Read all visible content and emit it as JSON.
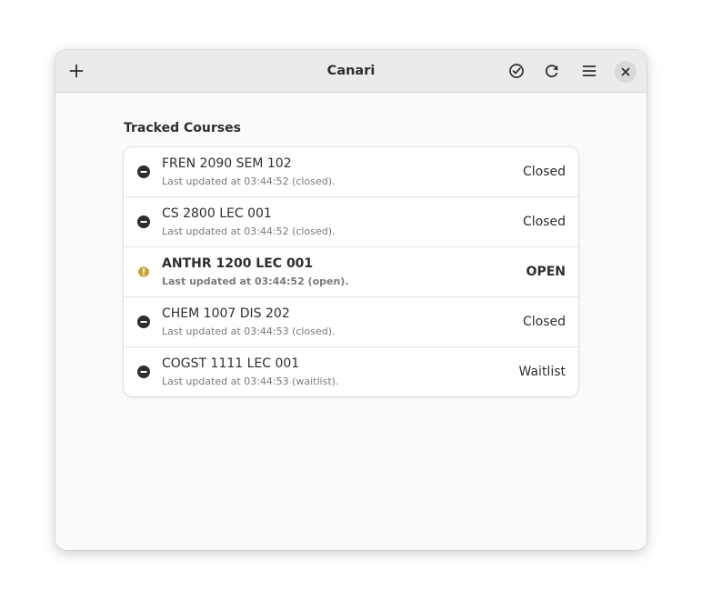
{
  "window": {
    "title": "Canari"
  },
  "headerbar": {
    "add_icon": "plus-icon",
    "check_icon": "check-circle-icon",
    "refresh_icon": "refresh-icon",
    "menu_icon": "hamburger-menu-icon",
    "close_icon": "close-icon"
  },
  "main": {
    "section_title": "Tracked Courses",
    "courses": [
      {
        "name": "FREN 2090 SEM 102",
        "updated": "Last updated at 03:44:52 (closed).",
        "status": "Closed",
        "icon": "minus-circle-icon"
      },
      {
        "name": "CS 2800 LEC 001",
        "updated": "Last updated at 03:44:52 (closed).",
        "status": "Closed",
        "icon": "minus-circle-icon"
      },
      {
        "name": "ANTHR 1200 LEC 001",
        "updated": "Last updated at 03:44:52 (open).",
        "status": "OPEN",
        "icon": "alert-badge-icon"
      },
      {
        "name": "CHEM 1007 DIS 202",
        "updated": "Last updated at 03:44:53 (closed).",
        "status": "Closed",
        "icon": "minus-circle-icon"
      },
      {
        "name": "COGST 1111 LEC 001",
        "updated": "Last updated at 03:44:53 (waitlist).",
        "status": "Waitlist",
        "icon": "minus-circle-icon"
      }
    ]
  },
  "colors": {
    "window_bg": "#fafafa",
    "headerbar_bg": "#ebebeb",
    "card_bg": "#ffffff",
    "text": "#2e2e2e",
    "subtext": "#7a7a7a",
    "alert": "#c8a13a"
  }
}
